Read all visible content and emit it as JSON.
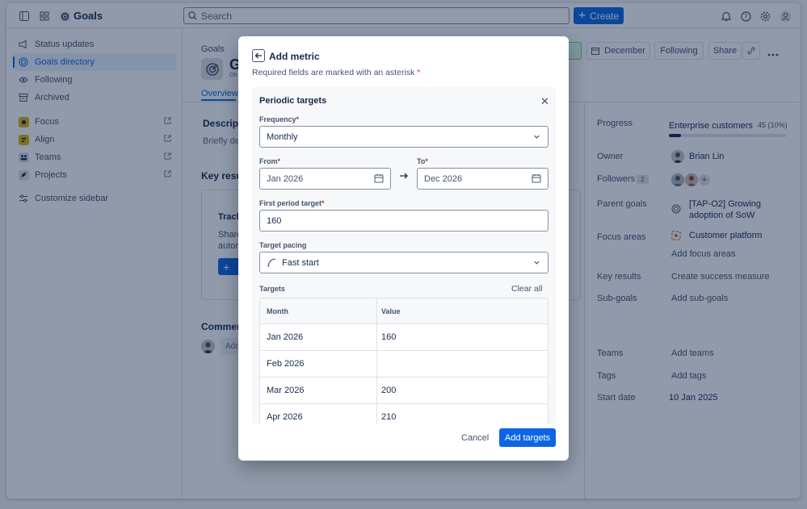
{
  "topbar": {
    "app_name": "Goals",
    "search_placeholder": "Search",
    "create_label": "Create"
  },
  "sidebar": {
    "items": [
      {
        "label": "Status updates",
        "icon": "megaphone-icon"
      },
      {
        "label": "Goals directory",
        "icon": "goal-icon",
        "active": true
      },
      {
        "label": "Following",
        "icon": "eye-icon"
      },
      {
        "label": "Archived",
        "icon": "archive-icon"
      }
    ],
    "apps": [
      {
        "label": "Focus",
        "color": "#e2b203"
      },
      {
        "label": "Align",
        "color": "#e2b203"
      },
      {
        "label": "Teams",
        "color": "#dfe1e6"
      },
      {
        "label": "Projects",
        "color": "#dfe1e6"
      }
    ],
    "customize_label": "Customize sidebar"
  },
  "page": {
    "breadcrumb": "Goals",
    "title": "G",
    "subtitle": "Ob",
    "tab_overview": "Overview",
    "description_head": "Descript",
    "description_placeholder": "Briefly des",
    "key_results_head": "Key resul",
    "card_title": "Track",
    "card_text1": "Share",
    "card_text2": "autom",
    "comments_head": "Commen",
    "comment_placeholder": "Add"
  },
  "header_buttons": {
    "month": "December",
    "following": "Following",
    "share": "Share"
  },
  "right_panel": {
    "progress_label": "Progress",
    "progress_metric": "Enterprise customers",
    "progress_value": "45 (10%)",
    "progress_fraction": 0.1,
    "owner_label": "Owner",
    "owner_name": "Brian Lin",
    "followers_label": "Followers",
    "followers_count": "2",
    "parent_goals_label": "Parent goals",
    "parent_goal_line1": "[TAP-O2] Growing",
    "parent_goal_line2": "adoption of SoW",
    "focus_areas_label": "Focus areas",
    "focus_area": "Customer platform",
    "add_focus_areas": "Add focus areas",
    "key_results_label": "Key results",
    "create_success_measure": "Create success measure",
    "sub_goals_label": "Sub-goals",
    "add_sub_goals": "Add sub-goals",
    "teams_label": "Teams",
    "add_teams": "Add teams",
    "tags_label": "Tags",
    "add_tags": "Add tags",
    "start_date_label": "Start date",
    "start_date": "10 Jan 2025"
  },
  "modal": {
    "title": "Add metric",
    "required_note": "Required fields are marked with an asterisk",
    "asterisk": "*",
    "panel_title": "Periodic targets",
    "frequency_label": "Frequency",
    "frequency_value": "Monthly",
    "from_label": "From",
    "from_value": "Jan 2026",
    "to_label": "To",
    "to_value": "Dec 2026",
    "first_target_label": "First period target",
    "first_target_value": "160",
    "pacing_label": "Target pacing",
    "pacing_value": "Fast start",
    "targets_label": "Targets",
    "clear_all": "Clear all",
    "table_headers": [
      "Month",
      "Value"
    ],
    "rows": [
      {
        "month": "Jan 2026",
        "value": "160"
      },
      {
        "month": "Feb 2026",
        "value": ""
      },
      {
        "month": "Mar 2026",
        "value": "200"
      },
      {
        "month": "Apr 2026",
        "value": "210"
      }
    ],
    "cancel_label": "Cancel",
    "submit_label": "Add targets"
  }
}
